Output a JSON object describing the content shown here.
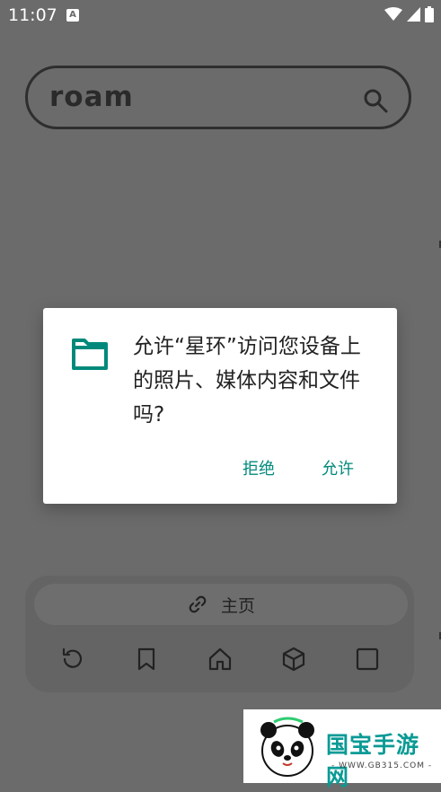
{
  "status_bar": {
    "time": "11:07",
    "notification_glyph": "A",
    "icons": [
      "wifi-icon",
      "signal-icon",
      "battery-icon"
    ]
  },
  "search": {
    "value": "roam",
    "icon": "search-icon"
  },
  "permission_dialog": {
    "icon": "folder-icon",
    "message": "允许“星环”访问您设备上的照片、媒体内容和文件吗?",
    "deny_label": "拒绝",
    "allow_label": "允许",
    "accent_color": "#00897b"
  },
  "bottom_bar": {
    "home_link_icon": "link-icon",
    "home_label": "主页",
    "nav_icons": [
      "refresh-icon",
      "bookmark-icon",
      "home-icon",
      "box-icon",
      "tabs-icon"
    ]
  },
  "watermark": {
    "title": "国宝手游网",
    "subtitle": "- WWW.GB315.COM -"
  }
}
